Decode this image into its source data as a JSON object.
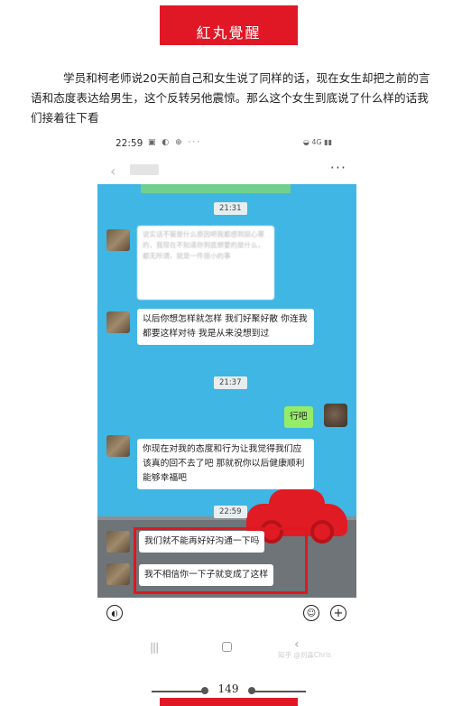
{
  "header": {
    "title": "紅丸覺醒"
  },
  "article": {
    "paragraph": "学员和柯老师说20天前自己和女生说了同样的话，现在女生却把之前的言语和态度表达给男生，这个反转另他震惊。那么这个女生到底说了什么样的话我们接着往下看"
  },
  "phone": {
    "status_time": "22:59",
    "status_right": "4G",
    "contact_name": "***",
    "input_bar": {
      "voice_icon": "voice-icon",
      "emoji_icon": "emoji-icon",
      "plus_icon": "plus-icon"
    },
    "watermark": "知乎 @刘淼Chris"
  },
  "chat": {
    "timestamps": [
      "21:31",
      "21:37",
      "22:59"
    ],
    "messages": [
      {
        "side": "left",
        "text": "说实话不管是什么原因吧我都感到挺心寒的，我现在不知道你到底想要的是什么，都无所谓，就是一件很小的事",
        "blurred": true
      },
      {
        "side": "left",
        "text": "以后你想怎样就怎样 我们好聚好散 你连我都要这样对待 我是从来没想到过"
      },
      {
        "side": "right",
        "text": "行吧"
      },
      {
        "side": "left",
        "text": "你现在对我的态度和行为让我觉得我们应该真的回不去了吧 那就祝你以后健康顺利 能够幸福吧"
      },
      {
        "side": "left",
        "text": "我们就不能再好好沟通一下吗"
      },
      {
        "side": "left",
        "text": "我不相信你一下子就变成了这样"
      }
    ]
  },
  "footer": {
    "page_number": "149"
  },
  "colors": {
    "brand_red": "#e01826",
    "chat_background": "#3fb6e4",
    "my_bubble": "#95ec69"
  }
}
